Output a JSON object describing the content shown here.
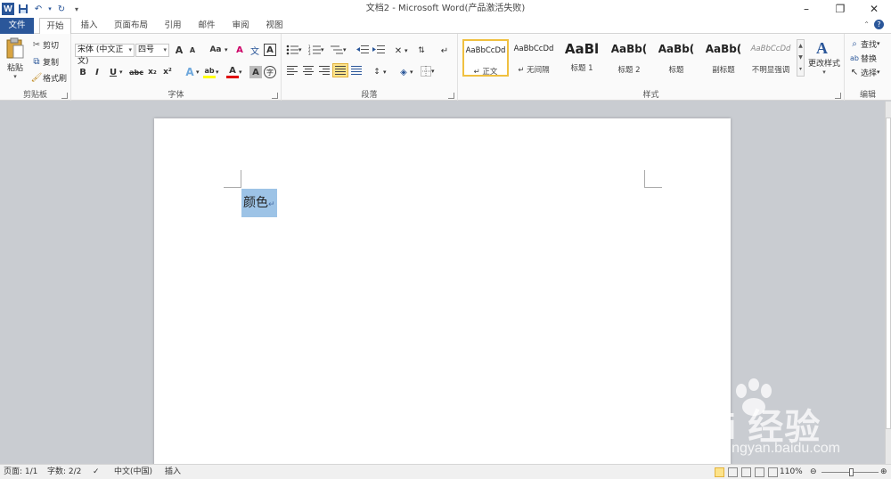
{
  "window": {
    "title": "文档2 - Microsoft Word(产品激活失败)",
    "logo_letter": "W"
  },
  "tabs": [
    "文件",
    "开始",
    "插入",
    "页面布局",
    "引用",
    "邮件",
    "审阅",
    "视图"
  ],
  "clipboard": {
    "paste": "粘贴",
    "cut": "剪切",
    "copy": "复制",
    "format_painter": "格式刷",
    "label": "剪贴板"
  },
  "font": {
    "name": "宋体 (中文正文)",
    "size": "四号",
    "grow": "A",
    "shrink": "A",
    "change_case": "Aa",
    "clear_format": "A",
    "phonetic": "文",
    "char_border": "A",
    "bold": "B",
    "italic": "I",
    "underline": "U",
    "strike": "abc",
    "sub": "x₂",
    "sup": "x²",
    "text_effect": "A",
    "highlight": "ab",
    "font_color": "A",
    "char_shading": "A",
    "enclose": "字",
    "label": "字体"
  },
  "paragraph": {
    "label": "段落"
  },
  "styles": {
    "label": "样式",
    "items": [
      {
        "sample": "AaBbCcDd",
        "name": "↵ 正文"
      },
      {
        "sample": "AaBbCcDd",
        "name": "↵ 无间隔"
      },
      {
        "sample": "AaBl",
        "name": "标题 1"
      },
      {
        "sample": "AaBb(",
        "name": "标题 2"
      },
      {
        "sample": "AaBb(",
        "name": "标题"
      },
      {
        "sample": "AaBb(",
        "name": "副标题"
      },
      {
        "sample": "AaBbCcDd",
        "name": "不明显强调"
      }
    ],
    "change_styles": "更改样式"
  },
  "editing": {
    "find": "查找",
    "replace": "替换",
    "select": "选择",
    "label": "编辑"
  },
  "document": {
    "text": "颜色",
    "paragraph_mark": "↵"
  },
  "status": {
    "page": "页面: 1/1",
    "words": "字数: 2/2",
    "language": "中文(中国)",
    "mode": "插入",
    "zoom": "110%"
  },
  "watermark": {
    "main": "Bai  经验",
    "sub": "jingyan.baidu.com"
  },
  "colors": {
    "accent": "#2b579a",
    "selection": "#9dc3e6",
    "highlight_yellow": "#ffff00",
    "font_red": "#e00000"
  }
}
